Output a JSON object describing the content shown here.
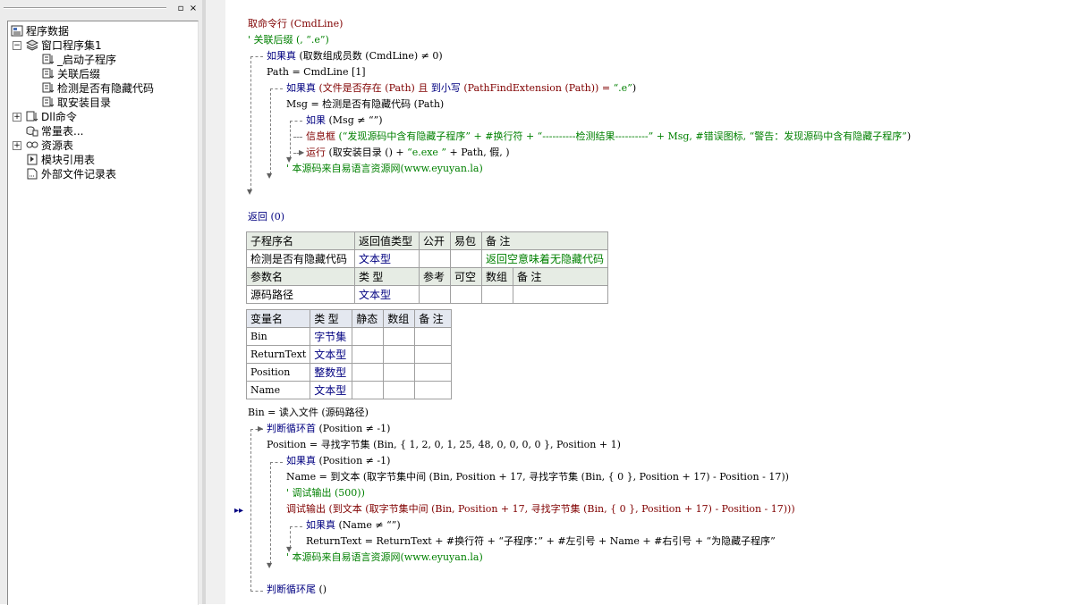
{
  "panel": {
    "restore_glyph": "▫",
    "close_glyph": "×"
  },
  "tree": {
    "root": "程序数据",
    "window_set": "窗口程序集1",
    "items": [
      "_启动子程序",
      "关联后缀",
      "检测是否有隐藏代码",
      "取安装目录"
    ],
    "dll": "Dll命令",
    "constants": "常量表...",
    "resources": "资源表",
    "modules": "模块引用表",
    "external": "外部文件记录表"
  },
  "code": {
    "l1": "取命令行 (CmdLine)",
    "l2": "' 关联后缀 (, “.e”)",
    "l3_kw": "如果真",
    "l3": " (取数组成员数 (CmdLine) ≠ 0)",
    "l4": "Path = CmdLine [1]",
    "l5_kw": "如果真",
    "l5a": " (文件是否存在 (Path) 且 ",
    "l5b": "到小写",
    "l5c": " (PathFindExtension (Path)) = ",
    "l5d": "“.e”",
    "l5e": ")",
    "l6": "Msg = 检测是否有隐藏代码 (Path)",
    "l7_kw": "如果",
    "l7": " (Msg ≠ “”)",
    "l8a": "信息框",
    "l8b": " (“发现源码中含有隐藏子程序” + #换行符 + “----------检测结果----------” + Msg, #错误图标, ",
    "l8c": "“警告：发现源码中含有隐藏子程序”",
    "l8d": ")",
    "l9a": "运行",
    "l9b": " (取安装目录 () + ",
    "l9c": "“e.exe ”",
    "l9d": " + Path, 假, )",
    "l10": "' 本源码来自易语言资源网(www.eyuyan.la)",
    "ret": "返回 (0)",
    "l20": "Bin = 读入文件 (源码路径)",
    "l21_kw": "判断循环首",
    "l21": " (Position ≠ -1)",
    "l22": "Position = 寻找字节集 (Bin, { 1, 2, 0, 1, 25, 48, 0, 0, 0, 0 }, Position + 1)",
    "l23_kw": "如果真",
    "l23": " (Position ≠ -1)",
    "l24": "Name = 到文本 (取字节集中间 (Bin, Position + 17, 寻找字节集 (Bin, { 0 }, Position + 17) - Position - 17))",
    "l25": "' 调试输出 (500))",
    "l26": "调试输出 (到文本 (取字节集中间 (Bin, Position + 17, 寻找字节集 (Bin, { 0 }, Position + 17) - Position - 17)))",
    "l27_kw": "如果真",
    "l27": " (Name ≠ “”)",
    "l28": "ReturnText = ReturnText + #换行符 + “子程序：” + #左引号 + Name + #右引号 + “为隐藏子程序”",
    "l29": "' 本源码来自易语言资源网(www.eyuyan.la)",
    "l30_kw": "判断循环尾",
    "l30": " ()"
  },
  "sub_table": {
    "h": [
      "子程序名",
      "返回值类型",
      "公开",
      "易包",
      "备 注"
    ],
    "r": [
      "检测是否有隐藏代码",
      "文本型",
      "",
      "",
      "返回空意味着无隐藏代码"
    ],
    "ph": [
      "参数名",
      "类 型",
      "参考",
      "可空",
      "数组",
      "备 注"
    ],
    "pr": [
      "源码路径",
      "文本型",
      "",
      "",
      "",
      ""
    ]
  },
  "var_table": {
    "h": [
      "变量名",
      "类 型",
      "静态",
      "数组",
      "备 注"
    ],
    "rows": [
      [
        "Bin",
        "字节集"
      ],
      [
        "ReturnText",
        "文本型"
      ],
      [
        "Position",
        "整数型"
      ],
      [
        "Name",
        "文本型"
      ]
    ]
  },
  "gutter": {
    "breakpoint": "▸▸"
  }
}
